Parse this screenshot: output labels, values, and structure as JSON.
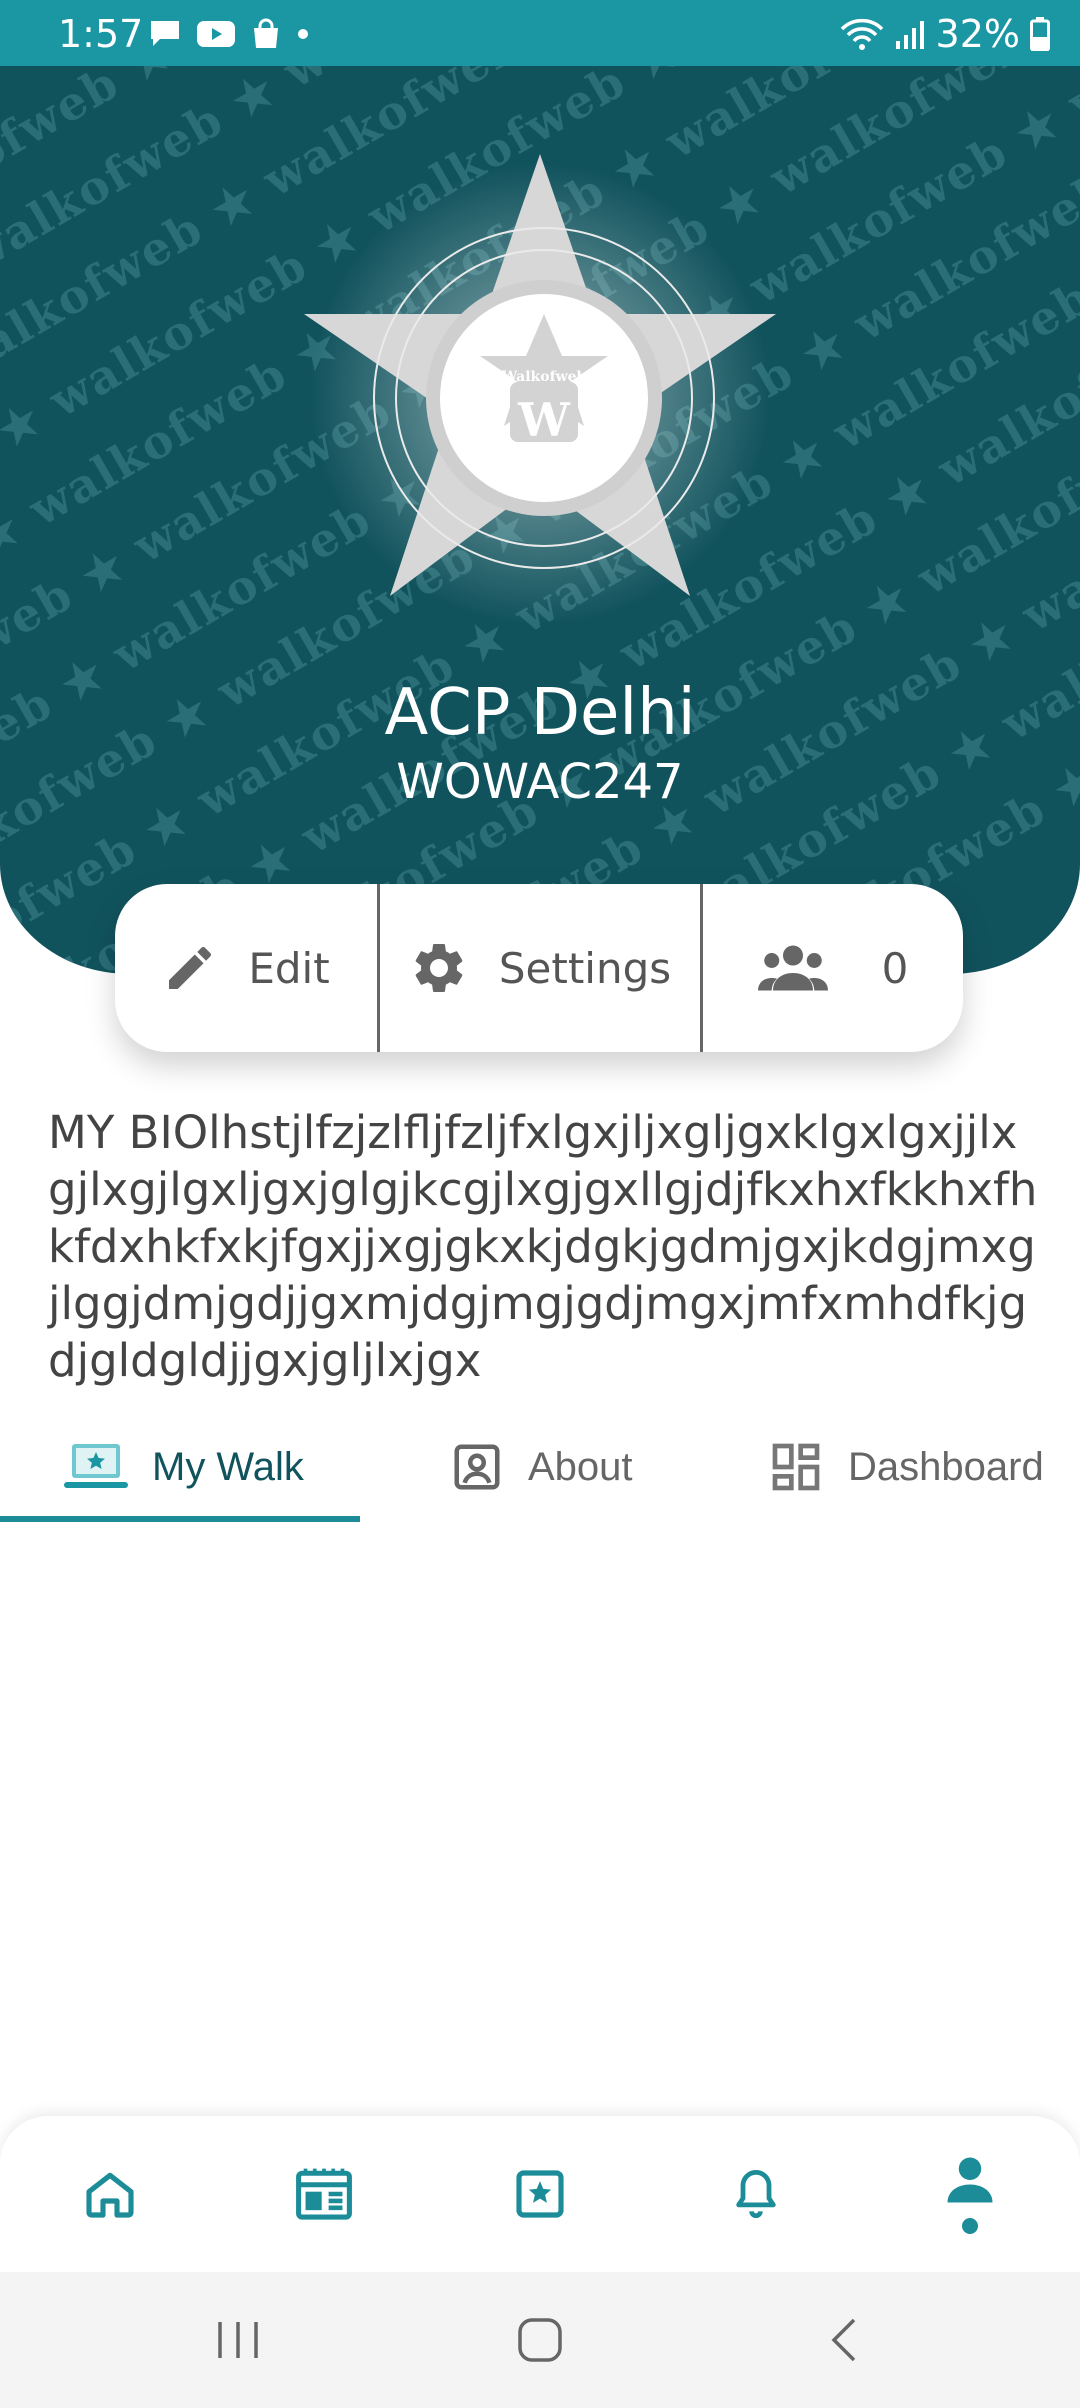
{
  "status_bar": {
    "time": "1:57",
    "battery": "32%"
  },
  "header": {
    "watermark_text": "walkofweb",
    "logo_text": "Walkofweb",
    "logo_letter": "W",
    "name": "ACP Delhi",
    "code": "WOWAC247"
  },
  "actions": {
    "edit_label": "Edit",
    "settings_label": "Settings",
    "followers_count": "0"
  },
  "bio": "MY BIOlhstjlfzjzlfljfzljfxlgxjljxgljgxklgxlgxjjlxgjlxgjlgxljgxjglgjkcgjlxgjgxllgjdjfkxhxfkkhxfhkfdxhkfxkjfgxjjxgjgkxkjdgkjgdmjgxjkdgjmxgjlggjdmjgdjjgxmjdgjmgjgdjmgxjmfxmhdfkjgdjgldgldjjgxjgljlxjgx",
  "tabs": [
    {
      "label": "My Walk",
      "active": true
    },
    {
      "label": "About",
      "active": false
    },
    {
      "label": "Dashboard",
      "active": false
    }
  ],
  "colors": {
    "accent": "#1b97a4",
    "header_bg": "#11535d",
    "active_tab_text": "#11535d",
    "inactive_tab_text": "#666666"
  },
  "bottom_nav": [
    "home-icon",
    "feed-icon",
    "walk-icon",
    "bell-icon",
    "profile-icon"
  ]
}
